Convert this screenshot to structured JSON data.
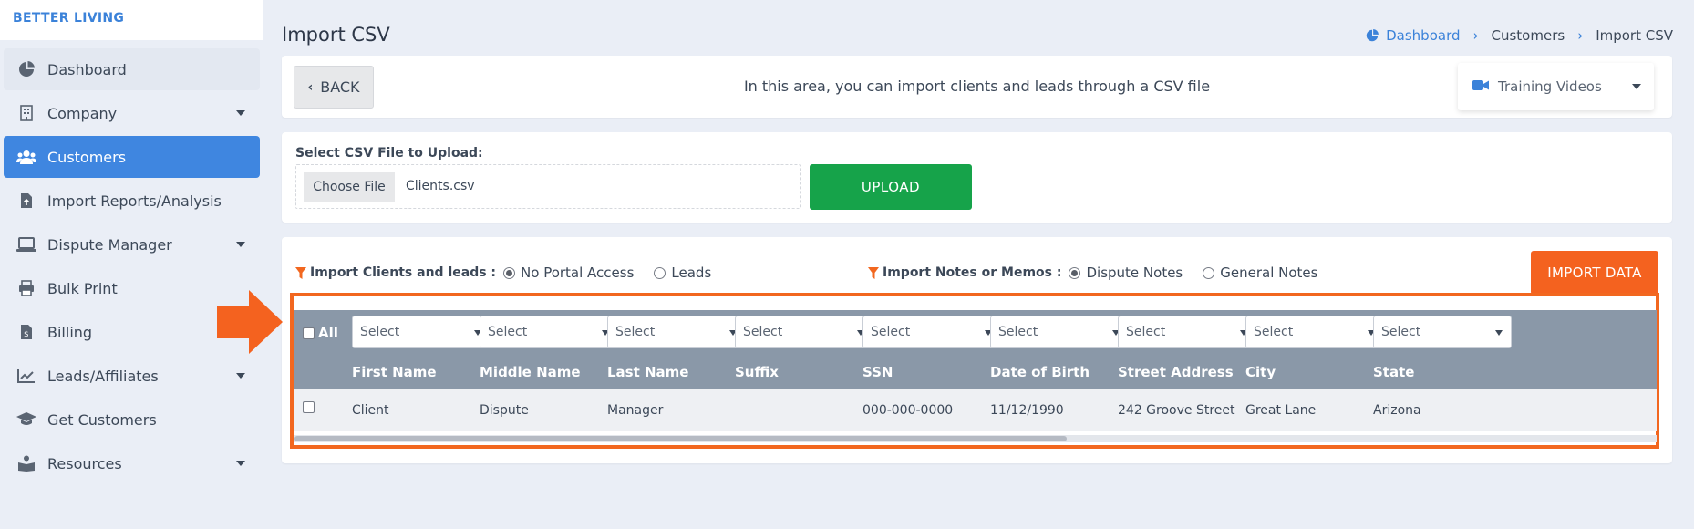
{
  "brand": "BETTER LIVING",
  "sidebar": {
    "items": [
      {
        "label": "Dashboard",
        "icon": "dashboard-icon"
      },
      {
        "label": "Company",
        "icon": "building-icon"
      },
      {
        "label": "Customers",
        "icon": "users-icon"
      },
      {
        "label": "Import Reports/Analysis",
        "icon": "file-import-icon"
      },
      {
        "label": "Dispute Manager",
        "icon": "laptop-icon"
      },
      {
        "label": "Bulk Print",
        "icon": "print-icon"
      },
      {
        "label": "Billing",
        "icon": "invoice-icon"
      },
      {
        "label": "Leads/Affiliates",
        "icon": "chart-line-icon"
      },
      {
        "label": "Get Customers",
        "icon": "graduation-cap-icon"
      },
      {
        "label": "Resources",
        "icon": "book-reader-icon"
      }
    ],
    "active": "Customers"
  },
  "page": {
    "title": "Import CSV",
    "breadcrumb": [
      "Dashboard",
      "Customers",
      "Import CSV"
    ]
  },
  "toolbar": {
    "back_label": "BACK",
    "info_text": "In this area, you can import clients and leads through a CSV file",
    "training_label": "Training Videos"
  },
  "upload": {
    "label": "Select CSV File to Upload:",
    "choose_label": "Choose File",
    "file_name": "Clients.csv",
    "upload_label": "UPLOAD"
  },
  "options": {
    "clients_label": "Import Clients and leads :",
    "clients_options": [
      "No Portal Access",
      "Leads"
    ],
    "clients_selected": "No Portal Access",
    "notes_label": "Import Notes or Memos :",
    "notes_options": [
      "Dispute Notes",
      "General Notes"
    ],
    "notes_selected": "Dispute Notes",
    "import_label": "IMPORT DATA"
  },
  "table": {
    "all_label": "All",
    "select_placeholder": "Select",
    "columns": [
      "First Name",
      "Middle Name",
      "Last Name",
      "Suffix",
      "SSN",
      "Date of Birth",
      "Street Address",
      "City",
      "State"
    ],
    "rows": [
      [
        "Client",
        "Dispute",
        "Manager",
        "",
        "000-000-0000",
        "11/12/1990",
        "242 Groove Street",
        "Great Lane",
        "Arizona"
      ]
    ]
  },
  "colors": {
    "accent": "#3f86e0",
    "upload_green": "#16a34a",
    "import_orange": "#f4621f",
    "highlight_orange": "#f2671f",
    "table_header": "#8a98a8"
  }
}
